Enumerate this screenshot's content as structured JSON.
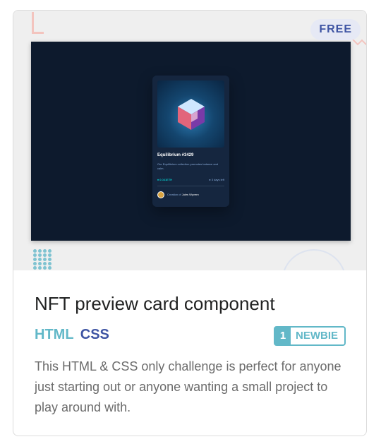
{
  "badge": {
    "label": "FREE"
  },
  "preview_card": {
    "title": "Equilibrium #3429",
    "description": "Our Equilibrium collection promotes balance and calm.",
    "price": "0.041ETH",
    "time_left": "3 days left",
    "creator_prefix": "Creation of",
    "creator_name": "Jules Wyvern"
  },
  "challenge": {
    "title": "NFT preview card component",
    "tags": [
      "HTML",
      "CSS"
    ],
    "level_number": "1",
    "level_label": "NEWBIE",
    "description": "This HTML & CSS only challenge is perfect for anyone just starting out or anyone wanting a small project to play around with."
  },
  "colors": {
    "html_tag": "#62b8c8",
    "css_tag": "#3e54a3",
    "badge_bg": "#e6e9f5",
    "preview_bg": "#0d1a2d"
  },
  "icons": [
    "ethereum-icon",
    "clock-icon",
    "avatar"
  ]
}
